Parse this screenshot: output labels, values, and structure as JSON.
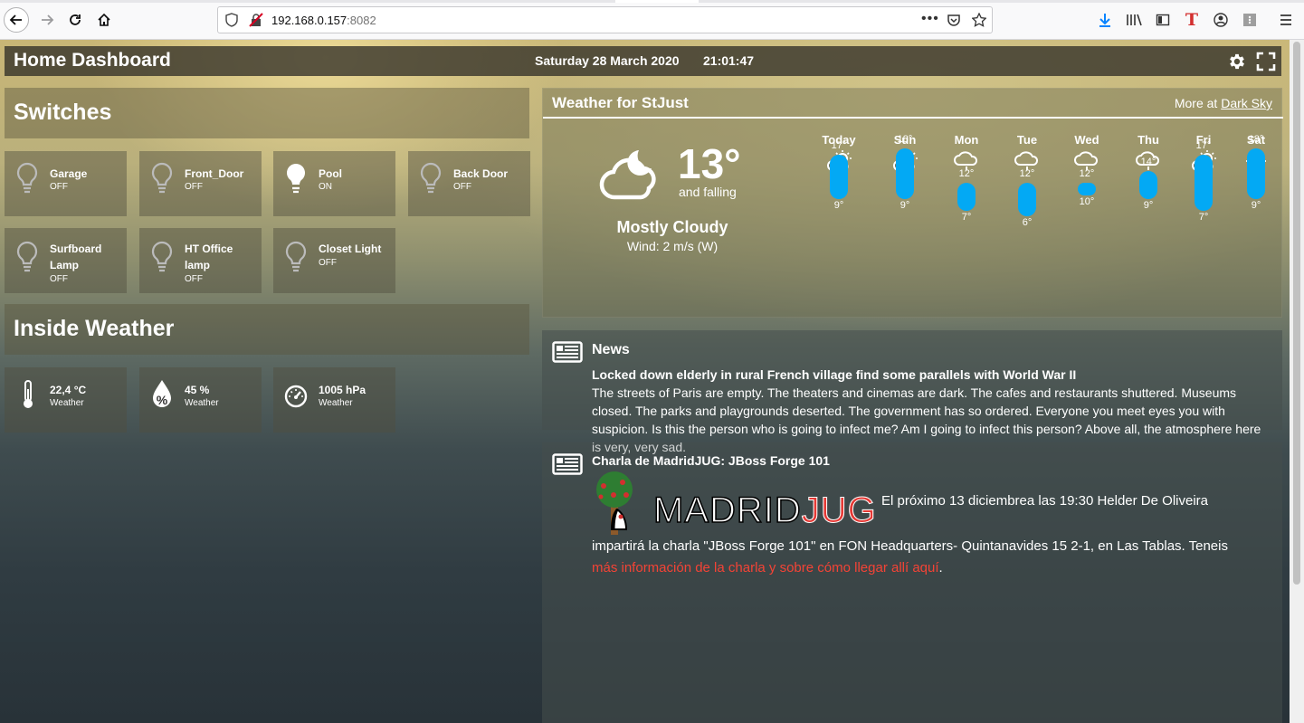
{
  "browser": {
    "url_host": "192.168.0.157",
    "url_port": ":8082"
  },
  "header": {
    "title": "Home Dashboard",
    "date": "Saturday 28 March 2020",
    "time": "21:01:47"
  },
  "switches": {
    "title": "Switches",
    "items": [
      {
        "name": "Garage",
        "state": "OFF"
      },
      {
        "name": "Front_Door",
        "state": "OFF"
      },
      {
        "name": "Pool",
        "state": "ON"
      },
      {
        "name": "Back Door",
        "state": "OFF"
      },
      {
        "name": "Surfboard Lamp",
        "state": "OFF"
      },
      {
        "name": "HT Office lamp",
        "state": "OFF"
      },
      {
        "name": "Closet Light",
        "state": "OFF"
      }
    ]
  },
  "inside_weather": {
    "title": "Inside Weather",
    "items": [
      {
        "value": "22,4 °C",
        "label": "Weather",
        "icon": "thermometer-icon"
      },
      {
        "value": "45 %",
        "label": "Weather",
        "icon": "humidity-icon"
      },
      {
        "value": "1005 hPa",
        "label": "Weather",
        "icon": "gauge-icon"
      }
    ]
  },
  "weather": {
    "title": "Weather for StJust",
    "more_prefix": "More at",
    "more_link": "Dark Sky",
    "current": {
      "temp": "13°",
      "trend": "and falling",
      "summary": "Mostly Cloudy",
      "wind": "Wind: 2 m/s (W)"
    },
    "forecast": [
      {
        "day": "Today",
        "hi": "17°",
        "lo": "9°",
        "icon": "partly-cloudy-icon",
        "high": 17,
        "low": 9
      },
      {
        "day": "Sun",
        "hi": "18°",
        "lo": "9°",
        "icon": "partly-cloudy-icon",
        "high": 18,
        "low": 9
      },
      {
        "day": "Mon",
        "hi": "12°",
        "lo": "7°",
        "icon": "rain-icon",
        "high": 12,
        "low": 7
      },
      {
        "day": "Tue",
        "hi": "12°",
        "lo": "6°",
        "icon": "rain-icon",
        "high": 12,
        "low": 6
      },
      {
        "day": "Wed",
        "hi": "12°",
        "lo": "10°",
        "icon": "rain-icon",
        "high": 12,
        "low": 10
      },
      {
        "day": "Thu",
        "hi": "14°",
        "lo": "9°",
        "icon": "rain-icon",
        "high": 14,
        "low": 9
      },
      {
        "day": "Fri",
        "hi": "17°",
        "lo": "7°",
        "icon": "partly-cloudy-icon",
        "high": 17,
        "low": 7
      },
      {
        "day": "Sat",
        "hi": "18°",
        "lo": "9°",
        "icon": "sun-icon",
        "high": 18,
        "low": 9
      }
    ]
  },
  "news": [
    {
      "title": "News",
      "headline": "Locked down elderly in rural French village find some parallels with World War II",
      "lines": [
        "The streets of Paris are empty. The theaters and cinemas are dark. The cafes and restaurants shuttered. Museums",
        "closed. The parks and playgrounds deserted. The government has so ordered. Everyone you meet eyes you with",
        "suspicion. Is this the person who is going to infect me? Am I going to infect this person? Above all, the atmosphere here",
        "is very, very sad."
      ]
    },
    {
      "headline": "Charla de MadridJUG: JBoss Forge 101",
      "logo_text_dark": "MADRID",
      "logo_text_red": "JUG",
      "inline_text": "El próximo 13 diciembrea las 19:30 Helder De Oliveira",
      "line2": "impartirá la charla \"JBoss Forge 101\" en FON Headquarters- Quintanavides 15 2-1, en Las Tablas. Teneis",
      "link_text": "más información de la charla y sobre cómo llegar allí aquí",
      "link_suffix": "."
    }
  ]
}
